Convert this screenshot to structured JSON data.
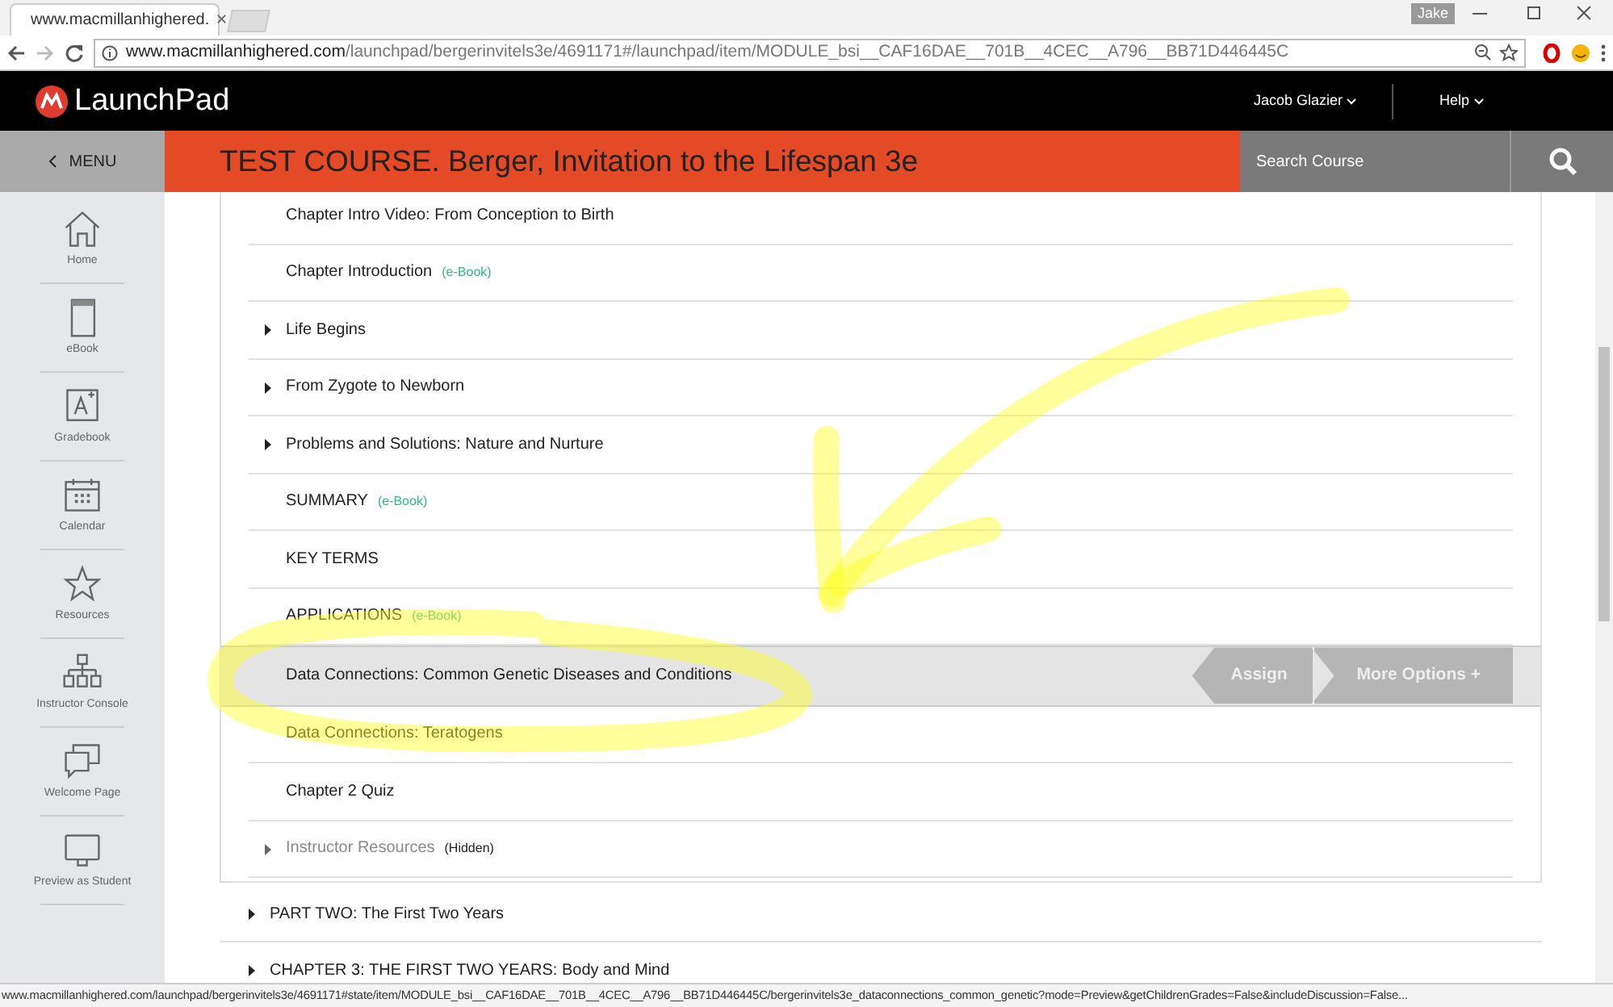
{
  "browser": {
    "tab_title": "www.macmillanhighered.",
    "tab_close": "✕",
    "user_badge": "Jake",
    "url_host": "www.macmillanhighered.com",
    "url_path": "/launchpad/bergerinvitels3e/4691171#/launchpad/item/MODULE_bsi__CAF16DAE__701B__4CEC__A796__BB71D446445C"
  },
  "header": {
    "logo": "LaunchPad",
    "user": "Jacob Glazier",
    "help": "Help"
  },
  "course_bar": {
    "menu": "MENU",
    "title": "TEST COURSE. Berger, Invitation to the Lifespan 3e",
    "search_placeholder": "Search Course"
  },
  "sidebar": {
    "items": [
      {
        "label": "Home"
      },
      {
        "label": "eBook"
      },
      {
        "label": "Gradebook"
      },
      {
        "label": "Calendar"
      },
      {
        "label": "Resources"
      },
      {
        "label": "Instructor Console"
      },
      {
        "label": "Welcome Page"
      },
      {
        "label": "Preview as Student"
      }
    ]
  },
  "chapter_items": [
    {
      "title": "Chapter Intro Video: From Conception to Birth",
      "expandable": false,
      "selected": false,
      "hidden": false
    },
    {
      "title": "Chapter Introduction",
      "tag": "(e-Book)",
      "expandable": false,
      "selected": false,
      "hidden": false
    },
    {
      "title": "Life Begins",
      "expandable": true,
      "selected": false,
      "hidden": false
    },
    {
      "title": "From Zygote to Newborn",
      "expandable": true,
      "selected": false,
      "hidden": false
    },
    {
      "title": "Problems and Solutions: Nature and Nurture",
      "expandable": true,
      "selected": false,
      "hidden": false
    },
    {
      "title": "SUMMARY",
      "tag": "(e-Book)",
      "expandable": false,
      "selected": false,
      "hidden": false
    },
    {
      "title": "KEY TERMS",
      "expandable": false,
      "selected": false,
      "hidden": false
    },
    {
      "title": "APPLICATIONS",
      "tag": "(e-Book)",
      "expandable": false,
      "selected": false,
      "hidden": false
    },
    {
      "title": "Data Connections: Common Genetic Diseases and Conditions",
      "expandable": false,
      "selected": true,
      "hidden": false
    },
    {
      "title": "Data Connections: Teratogens",
      "expandable": false,
      "selected": false,
      "hidden": false
    },
    {
      "title": "Chapter 2 Quiz",
      "expandable": false,
      "selected": false,
      "hidden": false
    },
    {
      "title": "Instructor Resources",
      "tag": "(Hidden)",
      "expandable": true,
      "selected": false,
      "hidden": true
    }
  ],
  "row_actions": {
    "assign": "Assign",
    "more": "More Options",
    "more_icon": "+"
  },
  "parts": [
    {
      "title": "PART TWO: The First Two Years"
    },
    {
      "title": "CHAPTER 3: THE FIRST TWO YEARS: Body and Mind"
    }
  ],
  "status_bar": "www.macmillanhighered.com/launchpad/bergerinvitels3e/4691171#state/item/MODULE_bsi__CAF16DAE__701B__4CEC__A796__BB71D446445C/bergerinvitels3e_dataconnections_common_genetic?mode=Preview&getChildrenGrades=False&includeDiscussion=False..."
}
